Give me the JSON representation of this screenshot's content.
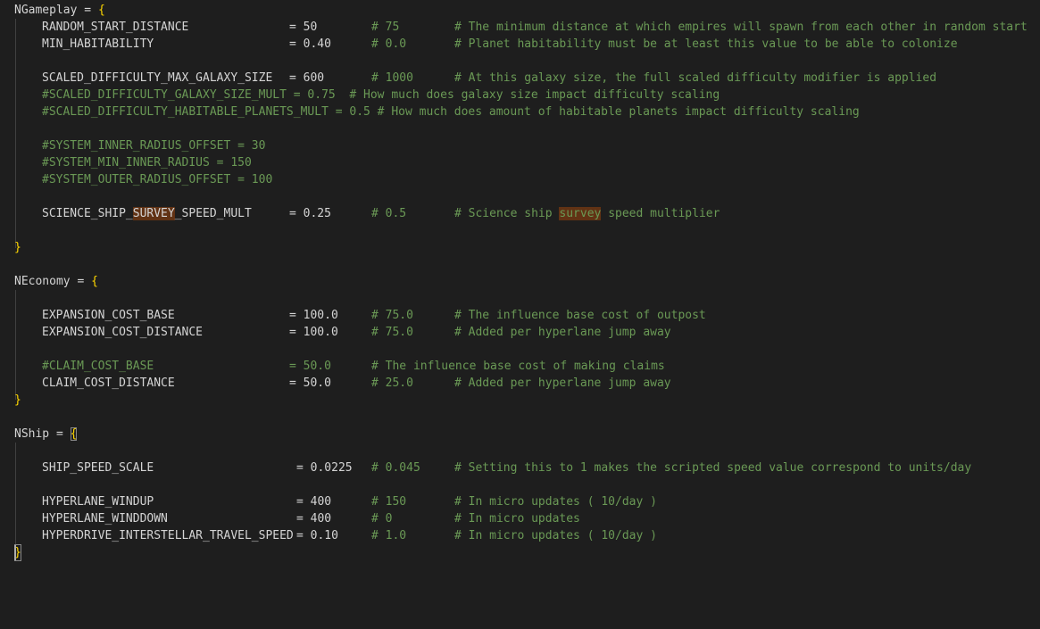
{
  "editor": {
    "blocks": [
      {
        "name": "NGameplay",
        "open": "NGameplay = {",
        "close": "}",
        "lines": [
          {
            "key": "RANDOM_START_DISTANCE",
            "assign": "= 50",
            "old": "# 75",
            "comment": "# The minimum distance at which empires will spawn from each other in random start"
          },
          {
            "key": "MIN_HABITABILITY",
            "assign": "= 0.40",
            "old": "# 0.0",
            "comment": "# Planet habitability must be at least this value to be able to colonize"
          },
          {
            "key": "SCALED_DIFFICULTY_MAX_GALAXY_SIZE",
            "assign": "= 600",
            "old": "# 1000",
            "comment": "# At this galaxy size, the full scaled difficulty modifier is applied"
          },
          {
            "full_comment": "#SCALED_DIFFICULTY_GALAXY_SIZE_MULT = 0.75  # How much does galaxy size impact difficulty scaling"
          },
          {
            "full_comment": "#SCALED_DIFFICULTY_HABITABLE_PLANETS_MULT = 0.5 # How much does amount of habitable planets impact difficulty scaling"
          },
          {
            "full_comment": "#SYSTEM_INNER_RADIUS_OFFSET = 30"
          },
          {
            "full_comment": "#SYSTEM_MIN_INNER_RADIUS = 150"
          },
          {
            "full_comment": "#SYSTEM_OUTER_RADIUS_OFFSET = 100"
          },
          {
            "key_pre": "SCIENCE_SHIP_",
            "key_hl": "SURVEY",
            "key_post": "_SPEED_MULT",
            "assign": "= 0.25",
            "old": "# 0.5",
            "comment_pre": "# Science ship ",
            "comment_hl": "survey",
            "comment_post": " speed multiplier"
          }
        ]
      },
      {
        "name": "NEconomy",
        "open": "NEconomy = {",
        "close": "}",
        "lines": [
          {
            "key": "EXPANSION_COST_BASE",
            "assign": "= 100.0",
            "old": "# 75.0",
            "comment": "# The influence base cost of outpost"
          },
          {
            "key": "EXPANSION_COST_DISTANCE",
            "assign": "= 100.0",
            "old": "# 75.0",
            "comment": "# Added per hyperlane jump away"
          },
          {
            "ckey": "#CLAIM_COST_BASE",
            "cassign": "= 50.0",
            "comment": "# The influence base cost of making claims"
          },
          {
            "key": "CLAIM_COST_DISTANCE",
            "assign": "= 50.0",
            "old": "# 25.0",
            "comment": "# Added per hyperlane jump away"
          }
        ]
      },
      {
        "name": "NShip",
        "open_name": "NShip = ",
        "open_brace": "{",
        "close": "}",
        "lines": [
          {
            "key": "SHIP_SPEED_SCALE",
            "assign": "= 0.0225",
            "old": "# 0.045",
            "comment": "# Setting this to 1 makes the scripted speed value correspond to units/day"
          },
          {
            "key": "HYPERLANE_WINDUP",
            "assign": "= 400",
            "old": "# 150",
            "comment": "# In micro updates ( 10/day )"
          },
          {
            "key": "HYPERLANE_WINDDOWN",
            "assign": "= 400",
            "old": "# 0",
            "comment": "# In micro updates"
          },
          {
            "key": "HYPERDRIVE_INTERSTELLAR_TRAVEL_SPEED",
            "assign": "= 0.10",
            "old": "# 1.0",
            "comment": "# In micro updates ( 10/day )"
          }
        ]
      }
    ]
  }
}
